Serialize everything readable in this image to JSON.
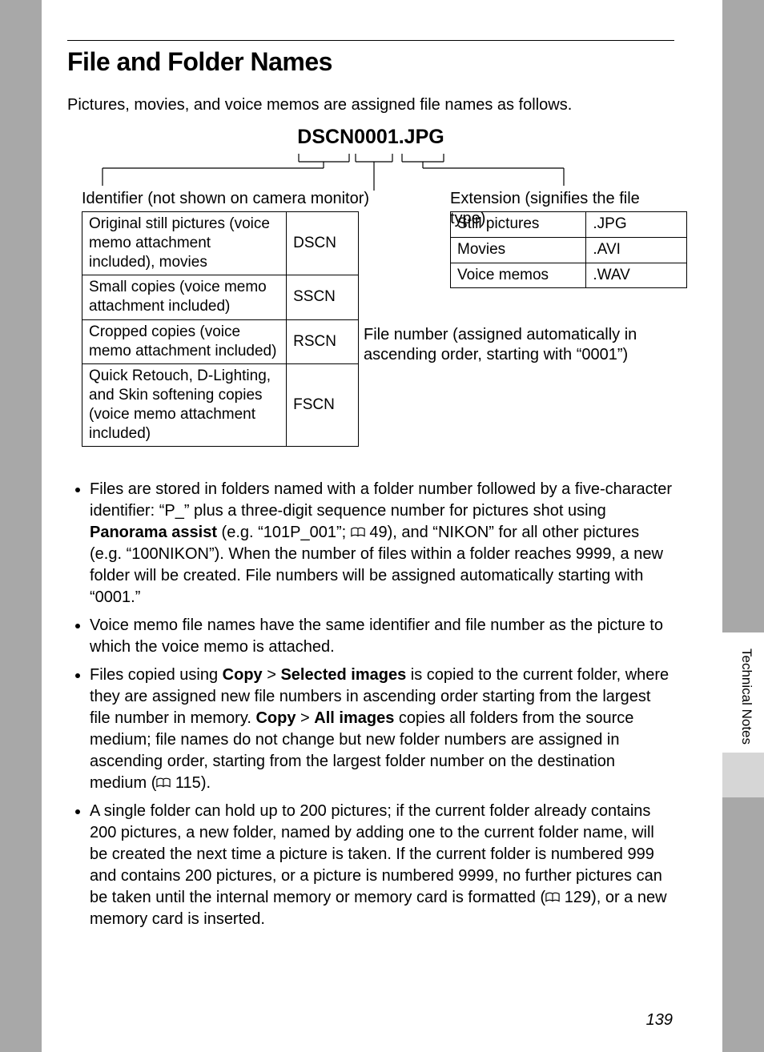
{
  "title": "File and Folder Names",
  "intro": "Pictures, movies, and voice memos are assigned file names as follows.",
  "example_filename": "DSCN0001.JPG",
  "labels": {
    "identifier": "Identifier (not shown on camera monitor)",
    "extension": "Extension (signifies the file type)",
    "file_number": "File number (assigned automatically in ascending order, starting with “0001”)"
  },
  "identifier_table": [
    {
      "desc": "Original still pictures (voice memo attachment included), movies",
      "code": "DSCN"
    },
    {
      "desc": "Small copies (voice memo attachment included)",
      "code": "SSCN"
    },
    {
      "desc": "Cropped copies (voice memo attachment included)",
      "code": "RSCN"
    },
    {
      "desc": "Quick Retouch, D-Lighting, and Skin softening copies (voice memo attachment included)",
      "code": "FSCN"
    }
  ],
  "extension_table": [
    {
      "type": "Still pictures",
      "ext": ".JPG"
    },
    {
      "type": "Movies",
      "ext": ".AVI"
    },
    {
      "type": "Voice memos",
      "ext": ".WAV"
    }
  ],
  "bullets": {
    "b1_pre": "Files are stored in folders named with a folder number followed by a five-character identifier: “P_” plus a three-digit sequence number for pictures shot using ",
    "b1_bold1": "Panorama assist",
    "b1_mid1": " (e.g. “101P_001”; ",
    "b1_ref1": "49",
    "b1_post": "), and “NIKON” for all other pictures (e.g. “100NIKON”). When the number of files within a folder reaches 9999, a new folder will be created. File numbers will be assigned automatically starting with “0001.”",
    "b2": "Voice memo file names have the same identifier and file number as the picture to which the voice memo is attached.",
    "b3_pre": "Files copied using ",
    "b3_bold1": "Copy",
    "b3_gt1": " > ",
    "b3_bold2": "Selected images",
    "b3_mid1": " is copied to the current folder, where they are assigned new file numbers in ascending order starting from the largest file number in memory. ",
    "b3_bold3": "Copy",
    "b3_gt2": " > ",
    "b3_bold4": "All images",
    "b3_mid2": " copies all folders from the source medium; file names do not change but new folder numbers are assigned in ascending order, starting from the largest folder number on the destination medium (",
    "b3_ref": "115",
    "b3_post": ").",
    "b4_pre": "A single folder can hold up to 200 pictures; if the current folder already contains 200 pictures, a new folder, named by adding one to the current folder name, will be created the next time a picture is taken. If the current folder is numbered 999 and contains 200 pictures, or a picture is numbered 9999, no further pictures can be taken until the internal memory or memory card is formatted (",
    "b4_ref": "129",
    "b4_post": "), or a new memory card is inserted."
  },
  "side_label": "Technical Notes",
  "page_number": "139"
}
